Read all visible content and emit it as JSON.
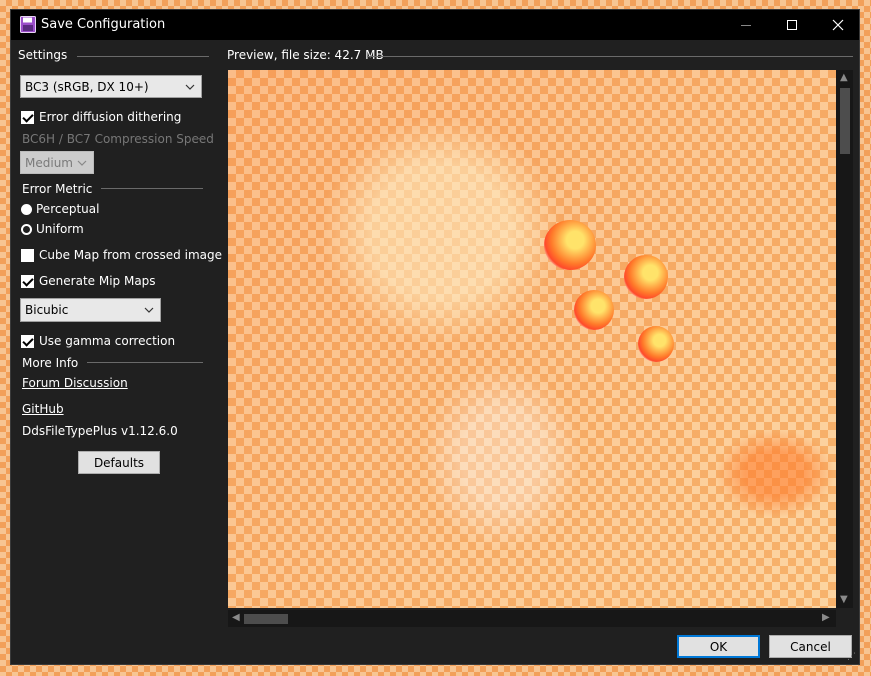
{
  "window": {
    "title": "Save Configuration"
  },
  "settings": {
    "heading": "Settings",
    "format_value": "BC3 (sRGB, DX 10+)",
    "error_diffusion_label": "Error diffusion dithering",
    "error_diffusion_checked": true,
    "bc_speed_label": "BC6H / BC7 Compression Speed",
    "bc_speed_value": "Medium",
    "error_metric_label": "Error Metric",
    "perceptual_label": "Perceptual",
    "uniform_label": "Uniform",
    "cube_map_label": "Cube Map from crossed image",
    "cube_map_checked": false,
    "mip_maps_label": "Generate Mip Maps",
    "mip_maps_checked": true,
    "filter_value": "Bicubic",
    "gamma_label": "Use gamma correction",
    "gamma_checked": true,
    "more_info_label": "More Info",
    "forum_link": "Forum Discussion",
    "github_link": "GitHub",
    "version": "DdsFileTypePlus v1.12.6.0",
    "defaults_button": "Defaults"
  },
  "preview": {
    "heading": "Preview, file size: 42.7 MB"
  },
  "footer": {
    "ok_button": "OK",
    "cancel_button": "Cancel"
  },
  "colors": {
    "window_bg": "#202020",
    "titlebar": "#000000",
    "accent": "#0078d7"
  }
}
